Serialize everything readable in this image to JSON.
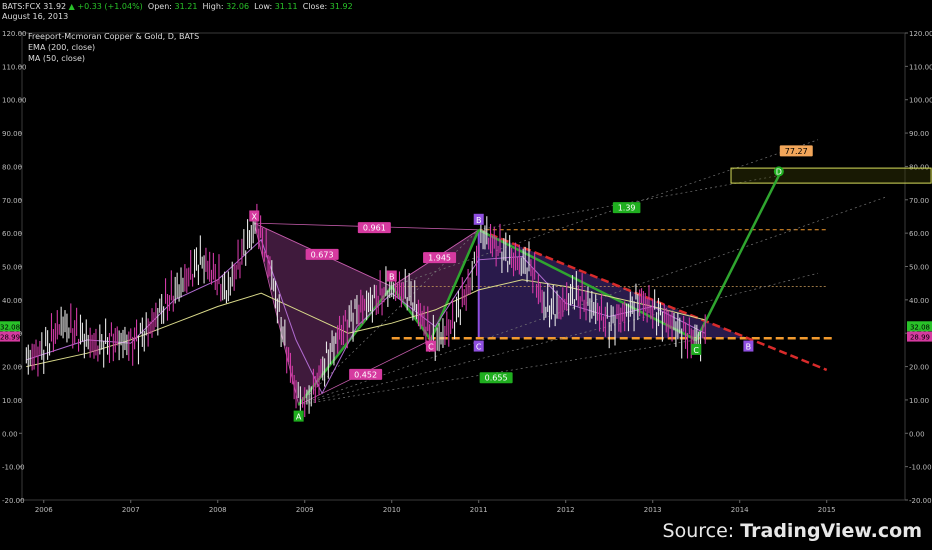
{
  "header": {
    "symbol": "BATS:FCX",
    "last": "31.92",
    "change": "+0.33 (+1.04%)",
    "open_label": "Open:",
    "open": "31.21",
    "high_label": "High:",
    "high": "32.06",
    "low_label": "Low:",
    "low": "31.11",
    "close_label": "Close:",
    "close": "31.92",
    "date": "August 16, 2013"
  },
  "legend": {
    "title": "Freeport-Mcmoran Copper & Gold, D, BATS",
    "ema": "EMA (200, close)",
    "ma": "MA (50, close)"
  },
  "source": {
    "prefix": "Source: ",
    "brand": "TradingView.com"
  },
  "colors": {
    "background": "#000000",
    "harmonic_green": "#2fa52f",
    "pattern_fill": "#8b3a86",
    "pattern_fill2": "#5b3aa6",
    "label_pink": "#d63aa0",
    "label_green": "#1fae1f",
    "label_purple": "#8f4fe0",
    "orange": "#f29a2e",
    "red": "#d92b2b",
    "price_up": "#29c229"
  },
  "chart_data": {
    "type": "line",
    "x_ticks": [
      "2006",
      "2007",
      "2008",
      "2009",
      "2010",
      "2011",
      "2012",
      "2013",
      "2014",
      "2015"
    ],
    "y_ticks": [
      "120.00",
      "110.00",
      "100.00",
      "90.00",
      "80.00",
      "70.00",
      "60.00",
      "50.00",
      "40.00",
      "30.00",
      "20.00",
      "10.00",
      "0.00",
      "-10.00",
      "-20.00"
    ],
    "ylim": [
      -20,
      120
    ],
    "xlim": [
      2005.75,
      2015.9
    ],
    "price_badge_top": "32.08",
    "price_badge_bottom": "28.99",
    "price_badges": [
      {
        "label": "32.08",
        "value": 32.08,
        "color": "#29c229"
      },
      {
        "label": "28.99",
        "value": 28.99,
        "color": "#d63aa0"
      }
    ],
    "price_series": [
      [
        2005.8,
        22
      ],
      [
        2006.0,
        25
      ],
      [
        2006.2,
        33
      ],
      [
        2006.4,
        30
      ],
      [
        2006.6,
        26
      ],
      [
        2006.8,
        28
      ],
      [
        2007.0,
        27
      ],
      [
        2007.2,
        31
      ],
      [
        2007.4,
        39
      ],
      [
        2007.6,
        45
      ],
      [
        2007.8,
        52
      ],
      [
        2007.95,
        48
      ],
      [
        2008.1,
        42
      ],
      [
        2008.3,
        55
      ],
      [
        2008.45,
        63
      ],
      [
        2008.6,
        50
      ],
      [
        2008.75,
        30
      ],
      [
        2008.9,
        12
      ],
      [
        2009.0,
        9
      ],
      [
        2009.1,
        13
      ],
      [
        2009.25,
        22
      ],
      [
        2009.4,
        30
      ],
      [
        2009.6,
        37
      ],
      [
        2009.8,
        40
      ],
      [
        2010.0,
        44
      ],
      [
        2010.2,
        42
      ],
      [
        2010.35,
        34
      ],
      [
        2010.5,
        27
      ],
      [
        2010.7,
        33
      ],
      [
        2010.9,
        45
      ],
      [
        2011.0,
        56
      ],
      [
        2011.05,
        60
      ],
      [
        2011.2,
        56
      ],
      [
        2011.4,
        52
      ],
      [
        2011.6,
        50
      ],
      [
        2011.75,
        38
      ],
      [
        2011.9,
        37
      ],
      [
        2012.1,
        42
      ],
      [
        2012.3,
        38
      ],
      [
        2012.5,
        33
      ],
      [
        2012.7,
        36
      ],
      [
        2012.85,
        40
      ],
      [
        2013.0,
        37
      ],
      [
        2013.2,
        33
      ],
      [
        2013.4,
        29
      ],
      [
        2013.55,
        28
      ],
      [
        2013.63,
        31.92
      ]
    ],
    "ema200": [
      [
        2005.8,
        20
      ],
      [
        2006.5,
        24
      ],
      [
        2007.0,
        28
      ],
      [
        2007.5,
        33
      ],
      [
        2008.0,
        38
      ],
      [
        2008.5,
        42
      ],
      [
        2009.0,
        36
      ],
      [
        2009.5,
        30
      ],
      [
        2010.0,
        33
      ],
      [
        2010.5,
        37
      ],
      [
        2011.0,
        43
      ],
      [
        2011.5,
        46
      ],
      [
        2012.0,
        44
      ],
      [
        2012.5,
        41
      ],
      [
        2013.0,
        38
      ],
      [
        2013.6,
        34
      ]
    ],
    "ma50": [
      [
        2005.8,
        22
      ],
      [
        2006.5,
        28
      ],
      [
        2007.0,
        27
      ],
      [
        2007.5,
        40
      ],
      [
        2008.0,
        46
      ],
      [
        2008.5,
        58
      ],
      [
        2008.9,
        28
      ],
      [
        2009.2,
        12
      ],
      [
        2009.6,
        32
      ],
      [
        2010.0,
        42
      ],
      [
        2010.5,
        32
      ],
      [
        2011.0,
        52
      ],
      [
        2011.5,
        53
      ],
      [
        2012.0,
        39
      ],
      [
        2012.5,
        35
      ],
      [
        2013.0,
        38
      ],
      [
        2013.6,
        30
      ]
    ],
    "xabcd_pattern": {
      "X": {
        "date": 2008.42,
        "value": 63
      },
      "A": {
        "date": 2008.93,
        "value": 8.5
      },
      "B": {
        "date": 2010.0,
        "value": 44
      },
      "C": {
        "date": 2010.45,
        "value": 28
      },
      "D": {
        "date": 2011.0,
        "value": 61
      },
      "ratios": [
        "0.673",
        "0.452",
        "1.945",
        "0.961"
      ]
    },
    "abcd_projection": {
      "A": {
        "date": 2008.93,
        "value": 8.5
      },
      "B": {
        "date": 2011.0,
        "value": 61
      },
      "C": {
        "date": 2013.5,
        "value": 28
      },
      "D": {
        "date": 2014.45,
        "value": 77.27
      },
      "ratios": [
        "0.655",
        "1.39"
      ],
      "target_label": "77.27"
    },
    "point_labels": [
      {
        "label": "X",
        "date": 2008.42,
        "value": 65,
        "color": "#d63aa0"
      },
      {
        "label": "A",
        "date": 2008.93,
        "value": 5,
        "color": "#1fae1f"
      },
      {
        "label": "B",
        "date": 2010.0,
        "value": 47,
        "color": "#d63aa0"
      },
      {
        "label": "C",
        "date": 2010.45,
        "value": 26,
        "color": "#d63aa0"
      },
      {
        "label": "B",
        "date": 2011.0,
        "value": 64,
        "color": "#8f4fe0"
      },
      {
        "label": "C",
        "date": 2011.0,
        "value": 26,
        "color": "#8f4fe0"
      },
      {
        "label": "C",
        "date": 2013.5,
        "value": 25,
        "color": "#1fae1f"
      },
      {
        "label": "B",
        "date": 2014.1,
        "value": 26,
        "color": "#8f4fe0"
      },
      {
        "label": "D",
        "date": 2014.45,
        "value": 78.5,
        "color": "#1fae1f"
      }
    ]
  }
}
